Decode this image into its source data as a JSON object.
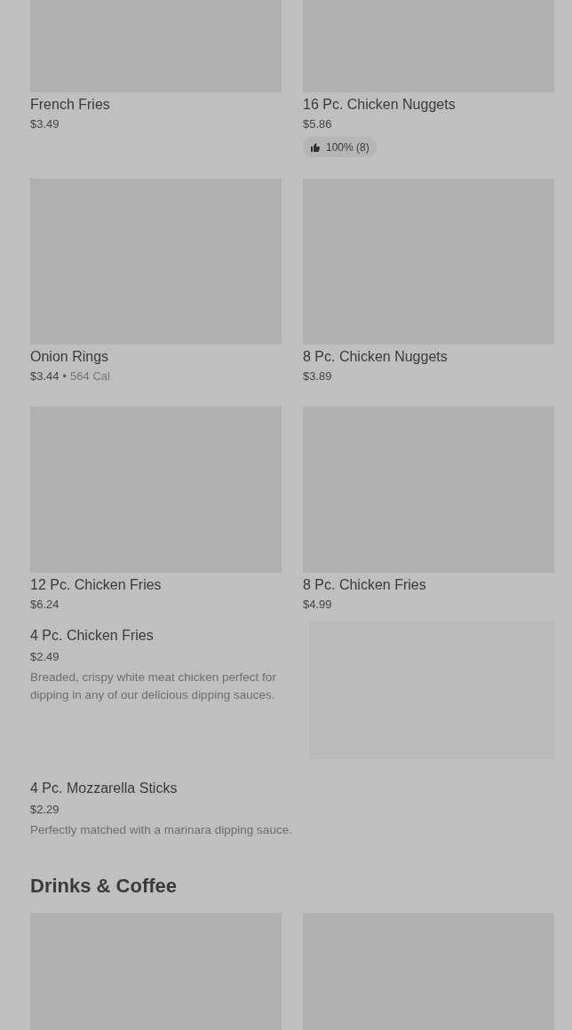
{
  "sections": [
    {
      "kind": "grid",
      "items": [
        {
          "kind": "item",
          "name": "French Fries",
          "price": "$3.49"
        },
        {
          "kind": "item",
          "name": "16 Pc. Chicken Nuggets",
          "price": "$5.86",
          "rating": "100% (8)"
        },
        {
          "kind": "item",
          "name": "Onion Rings",
          "price": "$3.44",
          "separator": "•",
          "calories": "564 Cal"
        },
        {
          "kind": "item",
          "name": "8 Pc. Chicken Nuggets",
          "price": "$3.89"
        },
        {
          "kind": "item",
          "name": "12 Pc. Chicken Fries",
          "price": "$6.24"
        },
        {
          "kind": "item",
          "name": "8 Pc. Chicken Fries",
          "price": "$4.99"
        }
      ]
    },
    {
      "kind": "list",
      "items": [
        {
          "name": "4 Pc. Chicken Fries",
          "price": "$2.49",
          "description": "Breaded, crispy white meat chicken perfect for dipping in any of our delicious dipping sauces.",
          "has_image": true
        },
        {
          "name": "4 Pc. Mozzarella Sticks",
          "price": "$2.29",
          "description": "Perfectly matched with a marinara dipping sauce.",
          "has_image": false
        }
      ]
    },
    {
      "kind": "heading",
      "title": "Drinks & Coffee"
    },
    {
      "kind": "grid"
    }
  ]
}
